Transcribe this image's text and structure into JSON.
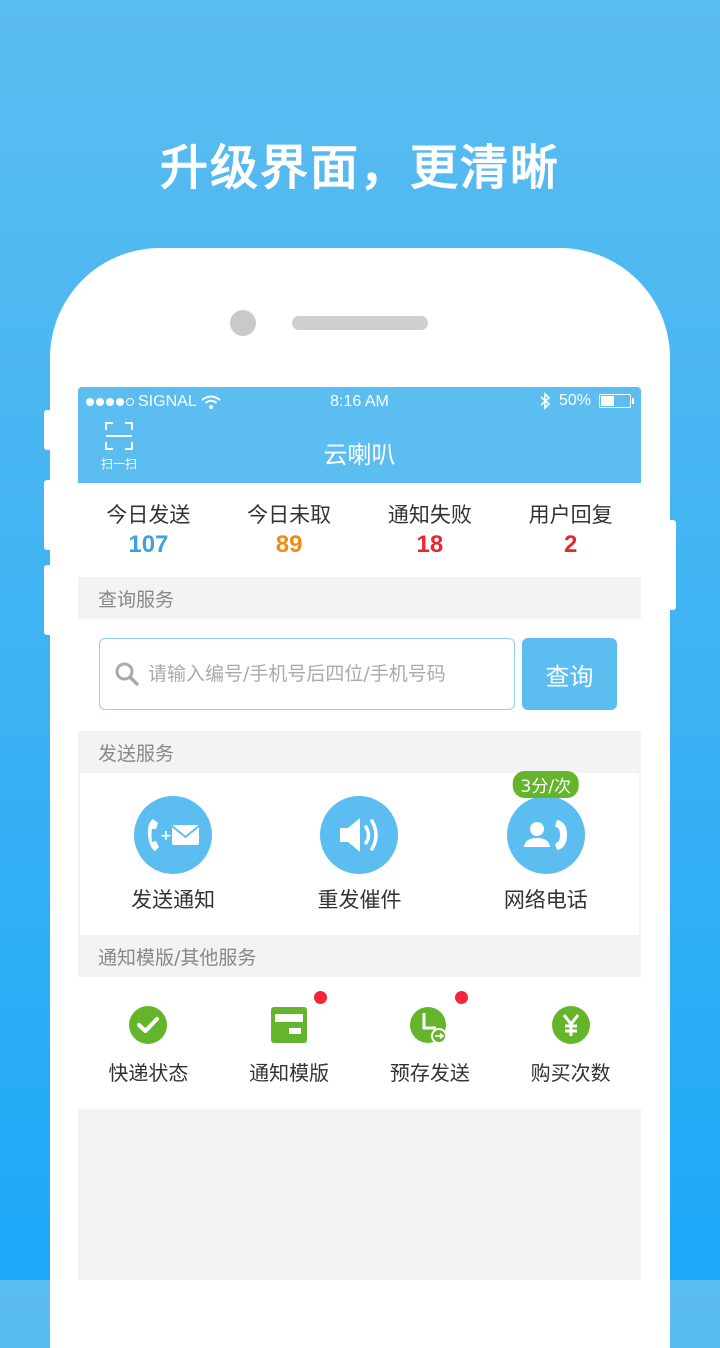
{
  "headline": "升级界面，更清晰",
  "status_bar": {
    "carrier": "SIGNAL",
    "time": "8:16 AM",
    "battery": "50%",
    "battery_level": 0.5
  },
  "nav": {
    "scan_label": "扫一扫",
    "title": "云喇叭"
  },
  "stats": [
    {
      "label": "今日发送",
      "value": "107",
      "color": "#3aa3e0"
    },
    {
      "label": "今日未取",
      "value": "89",
      "color": "#f08c12"
    },
    {
      "label": "通知失败",
      "value": "18",
      "color": "#e8262e"
    },
    {
      "label": "用户回复",
      "value": "2",
      "color": "#e8262e"
    }
  ],
  "query_section": {
    "title": "查询服务",
    "placeholder": "请输入编号/手机号后四位/手机号码",
    "button": "查询"
  },
  "send_section": {
    "title": "发送服务",
    "items": [
      {
        "label": "发送通知",
        "icon": "phone-mail-icon"
      },
      {
        "label": "重发催件",
        "icon": "speaker-icon"
      },
      {
        "label": "网络电话",
        "icon": "contact-call-icon",
        "badge": "3分/次"
      }
    ]
  },
  "other_section": {
    "title": "通知模版/其他服务",
    "items": [
      {
        "label": "快递状态",
        "icon": "check-circle-icon"
      },
      {
        "label": "通知模版",
        "icon": "template-card-icon",
        "dot": true
      },
      {
        "label": "预存发送",
        "icon": "scheduled-send-icon",
        "dot": true
      },
      {
        "label": "购买次数",
        "icon": "yuan-coin-icon"
      }
    ]
  },
  "colors": {
    "accent": "#5bbdf0",
    "green": "#64b42c",
    "red_dot": "#f2283a"
  }
}
